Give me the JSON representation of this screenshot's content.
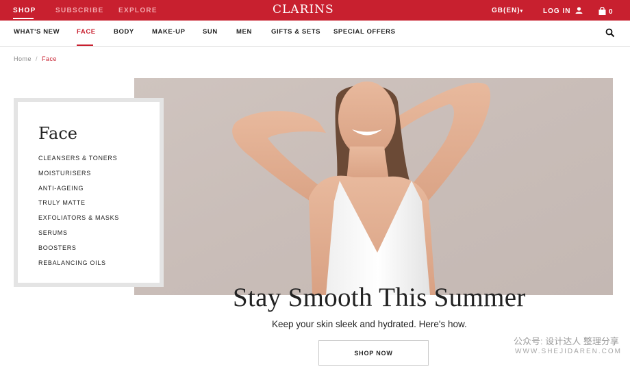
{
  "topbar": {
    "links": [
      "SHOP",
      "SUBSCRIBE",
      "EXPLORE"
    ],
    "logo": "CLARINS",
    "region": "GB(EN)",
    "login": "LOG IN",
    "cart_count": "0"
  },
  "nav": {
    "items": [
      "WHAT'S NEW",
      "FACE",
      "BODY",
      "MAKE-UP",
      "SUN",
      "MEN",
      "GIFTS & SETS",
      "SPECIAL OFFERS"
    ],
    "active": "FACE"
  },
  "breadcrumb": {
    "home": "Home",
    "separator": "/",
    "current": "Face"
  },
  "sidebar": {
    "title": "Face",
    "items": [
      "CLEANSERS & TONERS",
      "MOISTURISERS",
      "ANTI-AGEING",
      "TRULY MATTE",
      "EXFOLIATORS & MASKS",
      "SERUMS",
      "BOOSTERS",
      "REBALANCING OILS"
    ]
  },
  "hero": {
    "headline": "Stay Smooth This Summer",
    "subtext": "Keep your skin sleek and hydrated. Here's how.",
    "cta": "SHOP NOW"
  },
  "watermark": {
    "line1": "公众号: 设计达人 整理分享",
    "line2": "WWW.SHEJIDAREN.COM"
  },
  "colors": {
    "brand_red": "#c8202f",
    "border_gray": "#e4e4e4"
  }
}
